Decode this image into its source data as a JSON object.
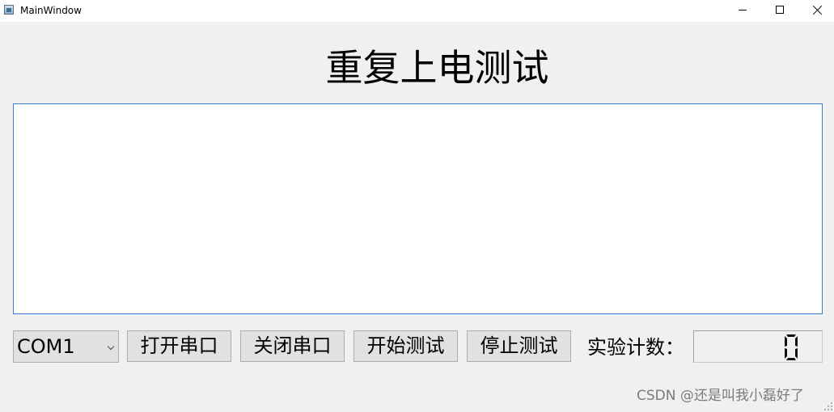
{
  "window": {
    "title": "MainWindow"
  },
  "main": {
    "title": "重复上电测试",
    "log_text": ""
  },
  "controls": {
    "port_select": {
      "value": "COM1"
    },
    "open_port_label": "打开串口",
    "close_port_label": "关闭串口",
    "start_test_label": "开始测试",
    "stop_test_label": "停止测试",
    "count_label": "实验计数：",
    "count_value": "0"
  },
  "watermark": "CSDN @还是叫我小磊好了",
  "colors": {
    "background": "#f0f0f0",
    "button_face": "#e1e1e1",
    "focus_border": "#3a7bd5"
  },
  "icons": {
    "app": "app-window-icon",
    "minimize": "minimize-icon",
    "maximize": "maximize-icon",
    "close": "close-icon",
    "dropdown": "chevron-down-icon",
    "resize": "size-grip-icon"
  }
}
